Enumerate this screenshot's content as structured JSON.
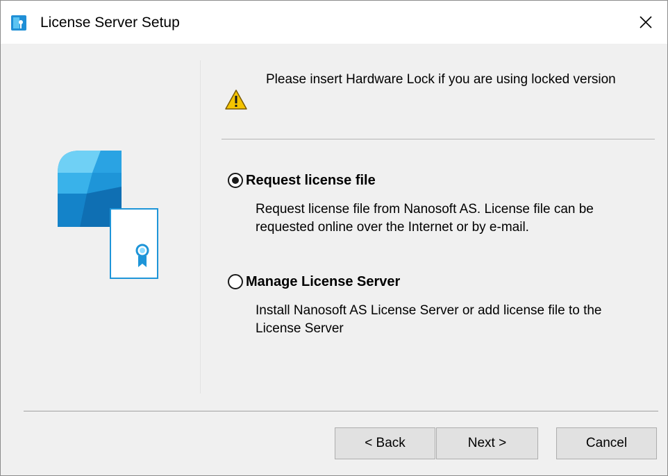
{
  "window": {
    "title": "License Server Setup",
    "icon": "license-key-app-icon",
    "close_icon": "close-icon",
    "colors": {
      "body_bg": "#f0f0f0",
      "titlebar_bg": "#ffffff",
      "button_bg": "#e1e1e1",
      "accent_blue": "#1f8fd6",
      "warning_yellow": "#f5c400"
    }
  },
  "notice": {
    "icon": "warning-icon",
    "text": "Please insert Hardware Lock if you are using locked version"
  },
  "options": [
    {
      "label": "Request license file",
      "description": "Request license file from Nanosoft AS. License file can be requested online over the Internet or by e-mail.",
      "selected": true
    },
    {
      "label": "Manage License Server",
      "description": "Install Nanosoft AS License Server or add license file to the License Server",
      "selected": false
    }
  ],
  "buttons": {
    "back": "< Back",
    "next": "Next >",
    "cancel": "Cancel"
  },
  "art": {
    "icon": "license-certificate-illustration"
  }
}
